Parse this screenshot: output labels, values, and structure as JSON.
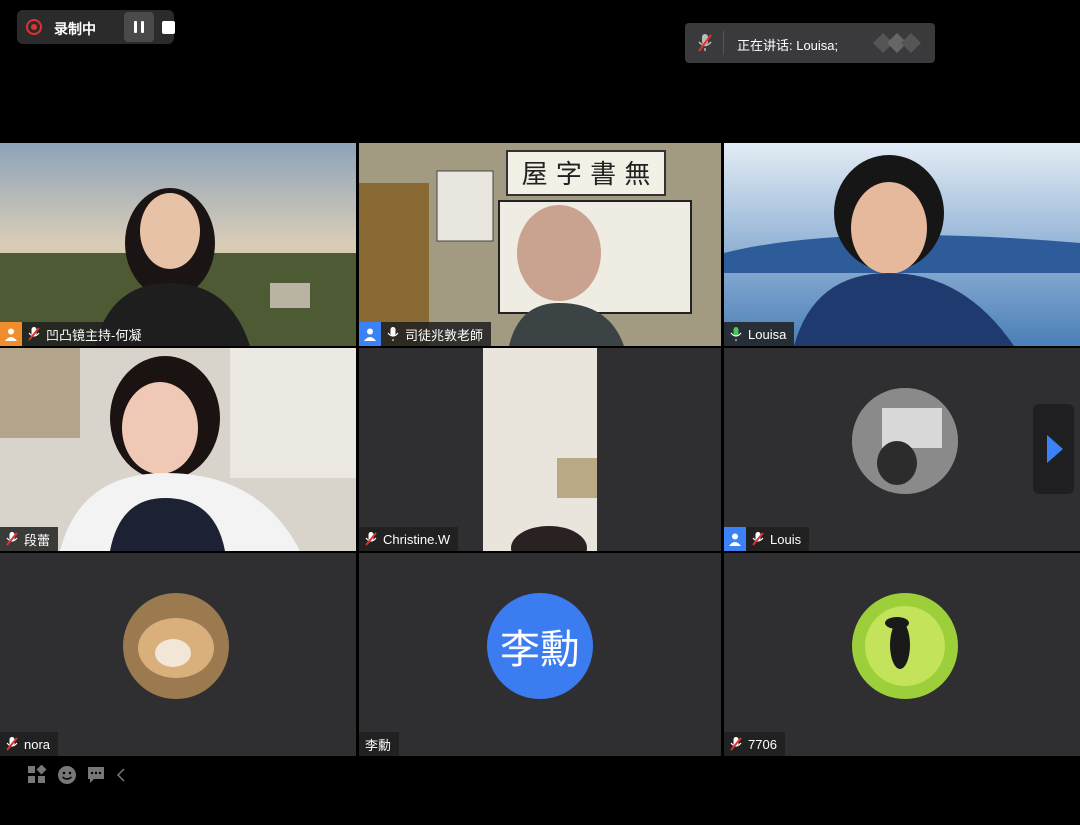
{
  "recording": {
    "label": "录制中"
  },
  "speaking": {
    "text": "正在讲话: Louisa;"
  },
  "participants": [
    {
      "name": "凹凸镜主持-何凝"
    },
    {
      "name": "司徒兆敦老師"
    },
    {
      "name": "Louisa"
    },
    {
      "name": "段蕾"
    },
    {
      "name": "Christine.W"
    },
    {
      "name": "Louis"
    },
    {
      "name": "nora"
    },
    {
      "name": "李勳",
      "initials": "李勳"
    },
    {
      "name": "7706"
    }
  ],
  "colors": {
    "accent": "#3b82f6",
    "active_speaker": "#4ac65a",
    "record": "#e03131",
    "host_badge": "#f08c2e"
  }
}
